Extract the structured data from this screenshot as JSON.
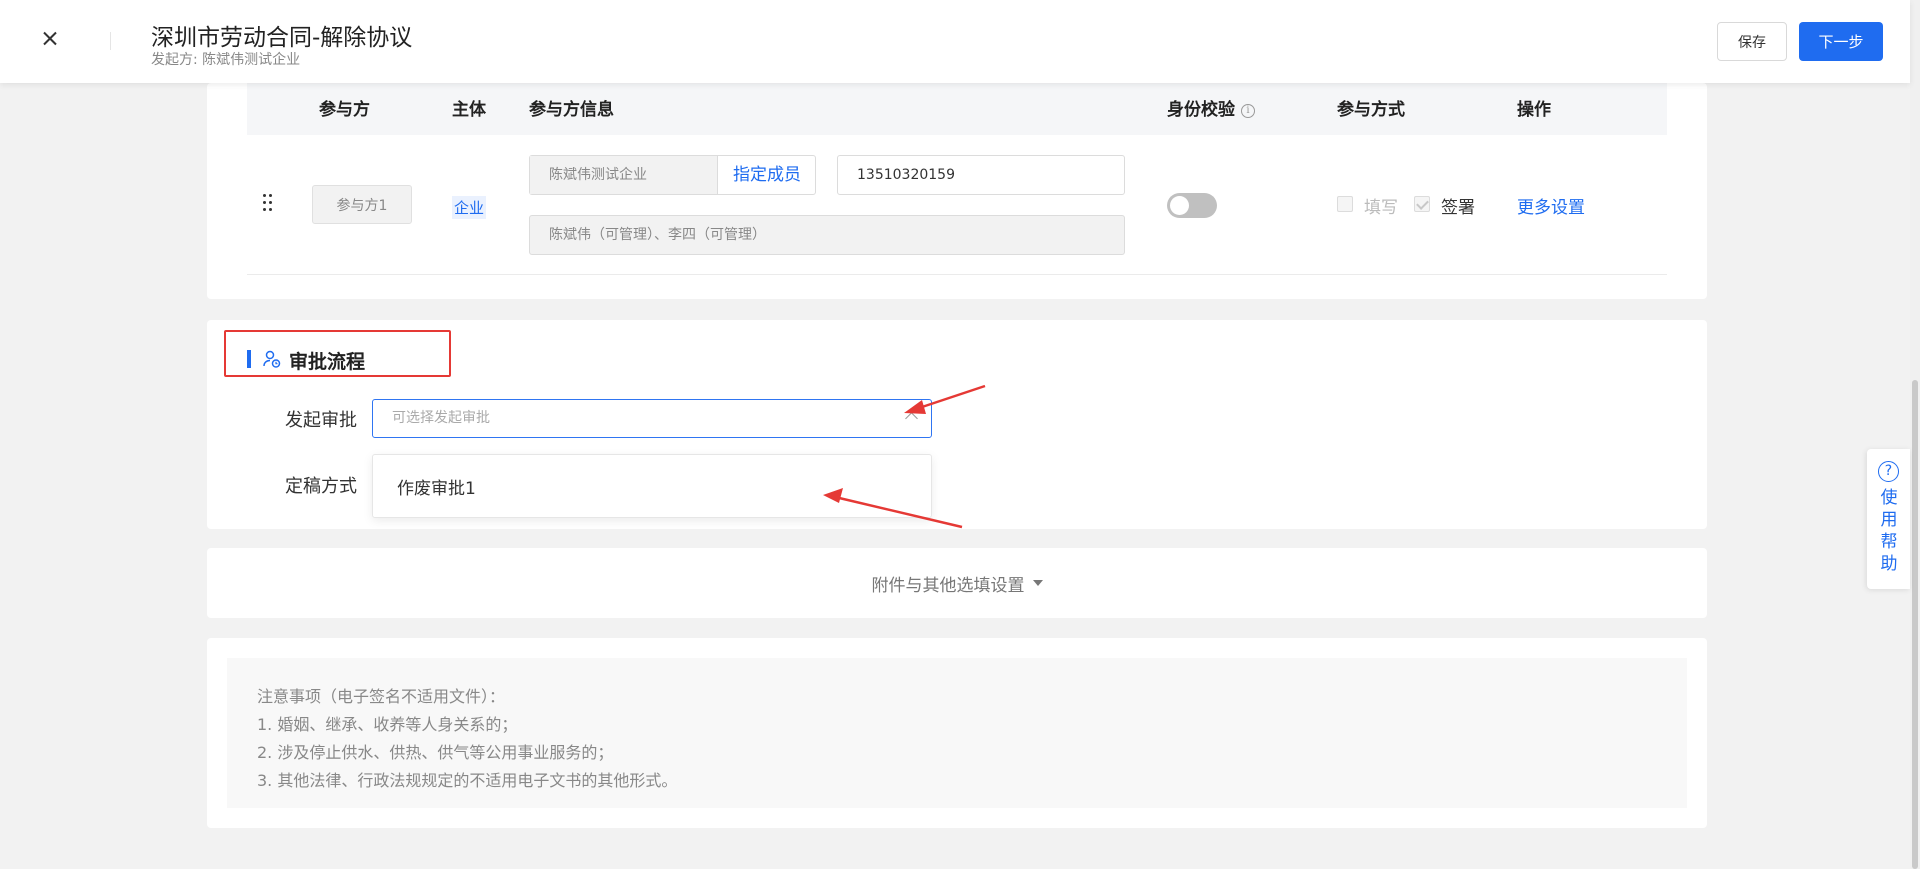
{
  "header": {
    "title": "深圳市劳动合同-解除协议",
    "subtitle": "发起方: 陈斌伟测试企业",
    "save_label": "保存",
    "next_label": "下一步"
  },
  "participants_table": {
    "columns": [
      "参与方",
      "主体",
      "参与方信息",
      "身份校验",
      "参与方式",
      "操作"
    ],
    "info_icon_glyph": "i",
    "row": {
      "party": "参与方1",
      "entity": "企业",
      "company": "陈斌伟测试企业",
      "assign_link": "指定成员",
      "phone": "13510320159",
      "members": "陈斌伟（可管理）、李四（可管理）",
      "identity_check_enabled": false,
      "method_fill_label": "填写",
      "method_fill_checked": false,
      "method_sign_label": "签署",
      "method_sign_checked": true,
      "action_link": "更多设置"
    }
  },
  "approval": {
    "section_title": "审批流程",
    "initiate_label": "发起审批",
    "select_placeholder": "可选择发起审批",
    "finalize_label": "定稿方式",
    "dropdown_options": [
      "作废审批1"
    ]
  },
  "attachments": {
    "toggle_label": "附件与其他选填设置"
  },
  "notes": {
    "lines": [
      "注意事项（电子签名不适用文件）：",
      "1. 婚姻、继承、收养等人身关系的；",
      "2. 涉及停止供水、供热、供气等公用事业服务的；",
      "3. 其他法律、行政法规规定的不适用电子文书的其他形式。"
    ]
  },
  "help": {
    "icon_glyph": "?",
    "label": "使用帮助"
  },
  "colors": {
    "primary": "#1f6cf0",
    "annotation_red": "#e53935"
  }
}
